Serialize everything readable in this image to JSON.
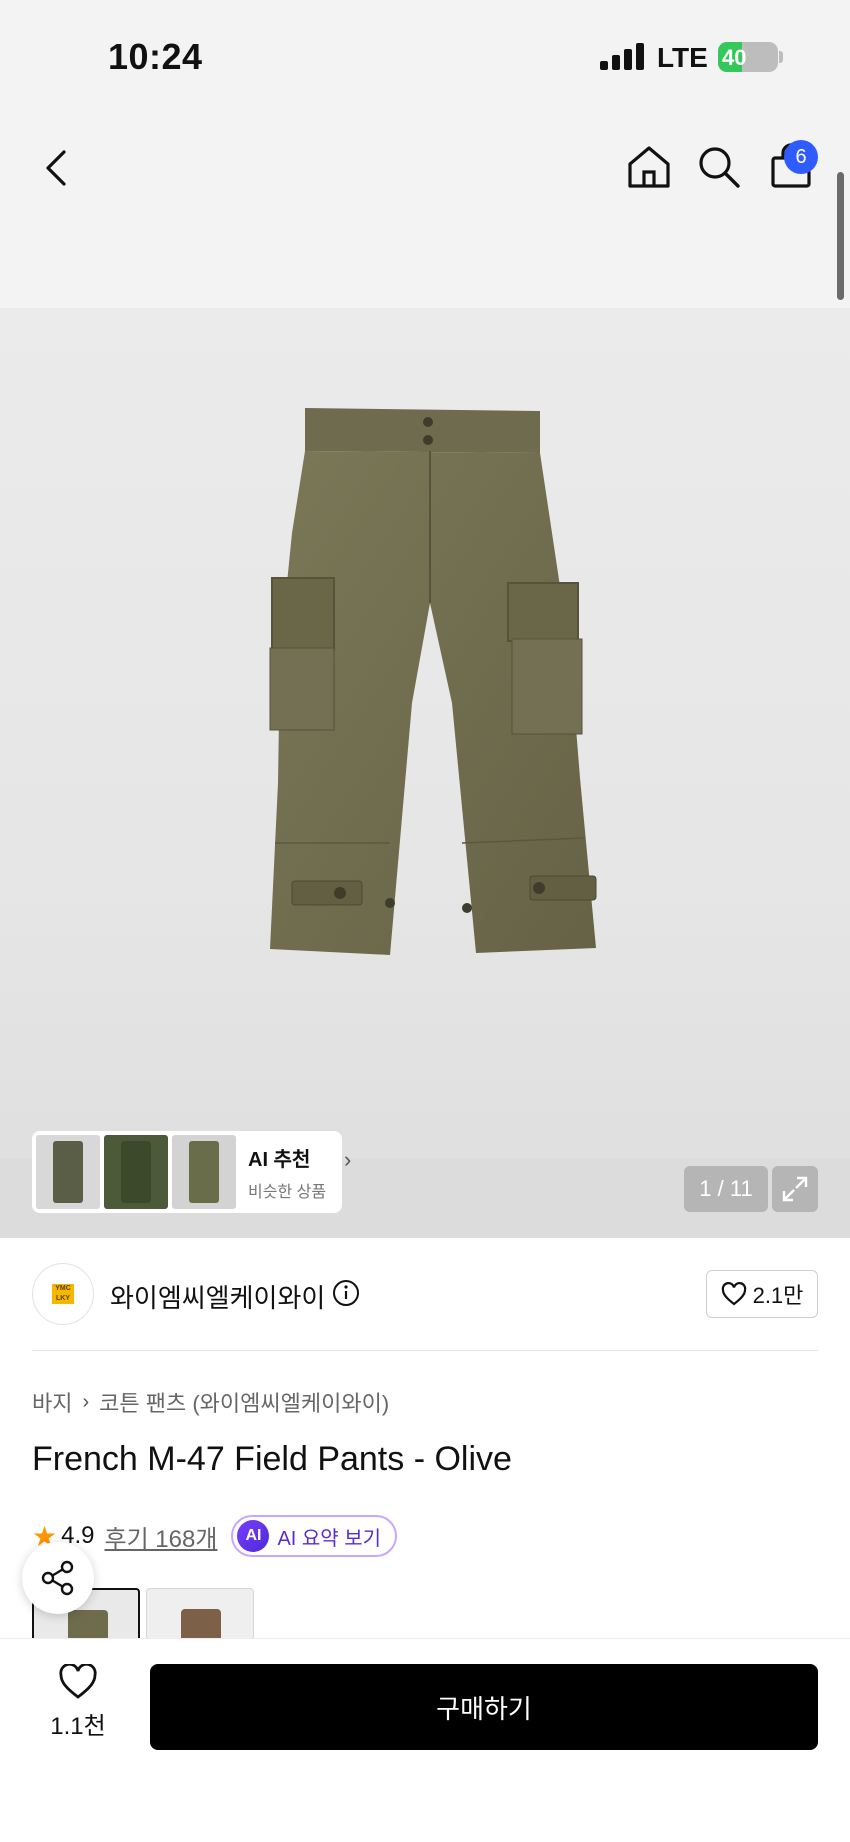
{
  "status_bar": {
    "time": "10:24",
    "network": "LTE",
    "battery": "40",
    "battery_level": 0.4
  },
  "nav": {
    "cart_count": "6"
  },
  "gallery": {
    "ai_title": "AI 추천",
    "ai_subtitle": "비슷한 상품",
    "pager": "1 / 11"
  },
  "brand": {
    "name": "와이엠씨엘케이와이",
    "logo_text": "YMC LKY",
    "likes": "2.1만"
  },
  "breadcrumb": {
    "category": "바지",
    "subcategory": "코튼 팬츠 (와이엠씨엘케이와이)"
  },
  "product": {
    "title": "French M-47 Field Pants - Olive",
    "rating": "4.9",
    "reviews": "후기 168개",
    "ai_badge": "AI",
    "ai_summary": "AI 요약 보기"
  },
  "colors": {
    "olive": "#6f6b4d",
    "brown": "#7d6048",
    "accent_blue": "#2f5bff",
    "star": "#ff9500",
    "ai_purple": "#5b2bd6"
  },
  "bottom_bar": {
    "wish_count": "1.1천",
    "buy_label": "구매하기"
  }
}
